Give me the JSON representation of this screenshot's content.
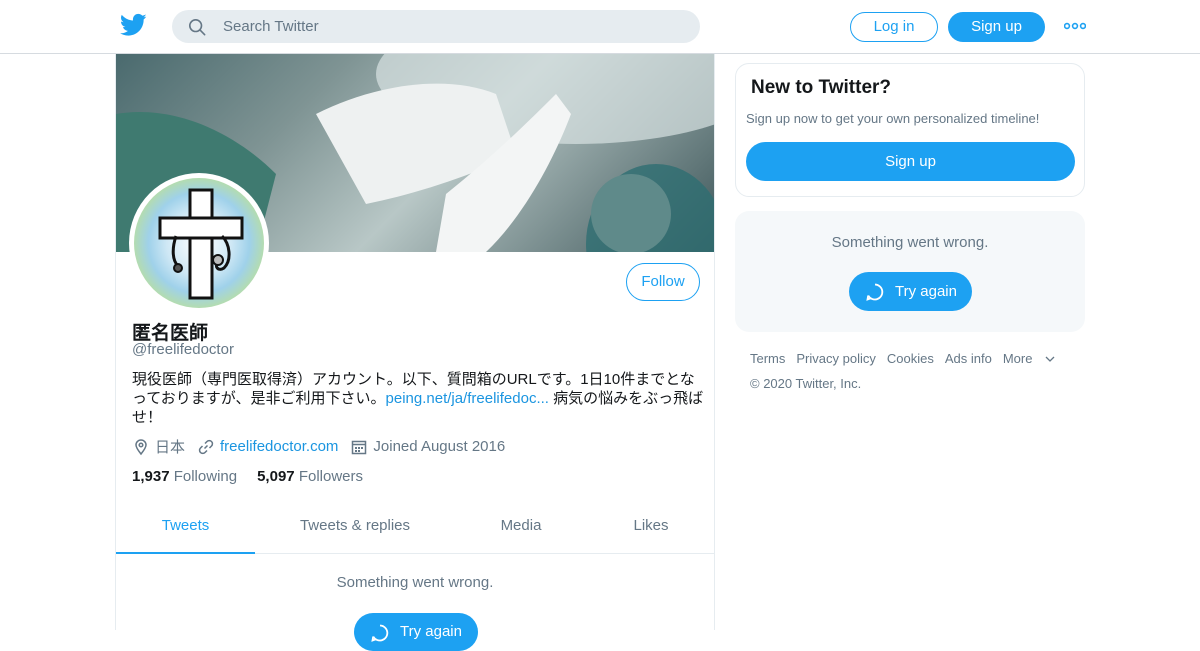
{
  "header": {
    "logo": "twitter-bird-icon",
    "search_placeholder": "Search Twitter",
    "login_label": "Log in",
    "signup_label": "Sign up",
    "more_icon": "more-dots-icon",
    "brand_color": "#1da1f2"
  },
  "profile": {
    "name": "匿名医師",
    "handle": "@freelifedoctor",
    "follow_label": "Follow",
    "bio_text_1": "現役医師（専門医取得済）アカウント。以下、質問箱のURLです。1日10件までとなっておりますが、是非ご利用下さい。",
    "bio_link": "peing.net/ja/freelifedoc...",
    "bio_text_2": " 病気の悩みをぶっ飛ばせ！",
    "location": "日本",
    "website": "freelifedoctor.com",
    "joined": "Joined August 2016",
    "following_count": "1,937",
    "following_label": "Following",
    "followers_count": "5,097",
    "followers_label": "Followers"
  },
  "tabs": [
    {
      "label": "Tweets",
      "active": true
    },
    {
      "label": "Tweets & replies",
      "active": false
    },
    {
      "label": "Media",
      "active": false
    },
    {
      "label": "Likes",
      "active": false
    }
  ],
  "timeline": {
    "error_message": "Something went wrong.",
    "retry_label": "Try again"
  },
  "sidebar": {
    "new_title": "New to Twitter?",
    "new_subtitle": "Sign up now to get your own personalized timeline!",
    "signup_label": "Sign up",
    "error_message": "Something went wrong.",
    "retry_label": "Try again"
  },
  "footer": {
    "links": [
      "Terms",
      "Privacy policy",
      "Cookies",
      "Ads info",
      "More"
    ],
    "copyright": "© 2020 Twitter, Inc."
  }
}
